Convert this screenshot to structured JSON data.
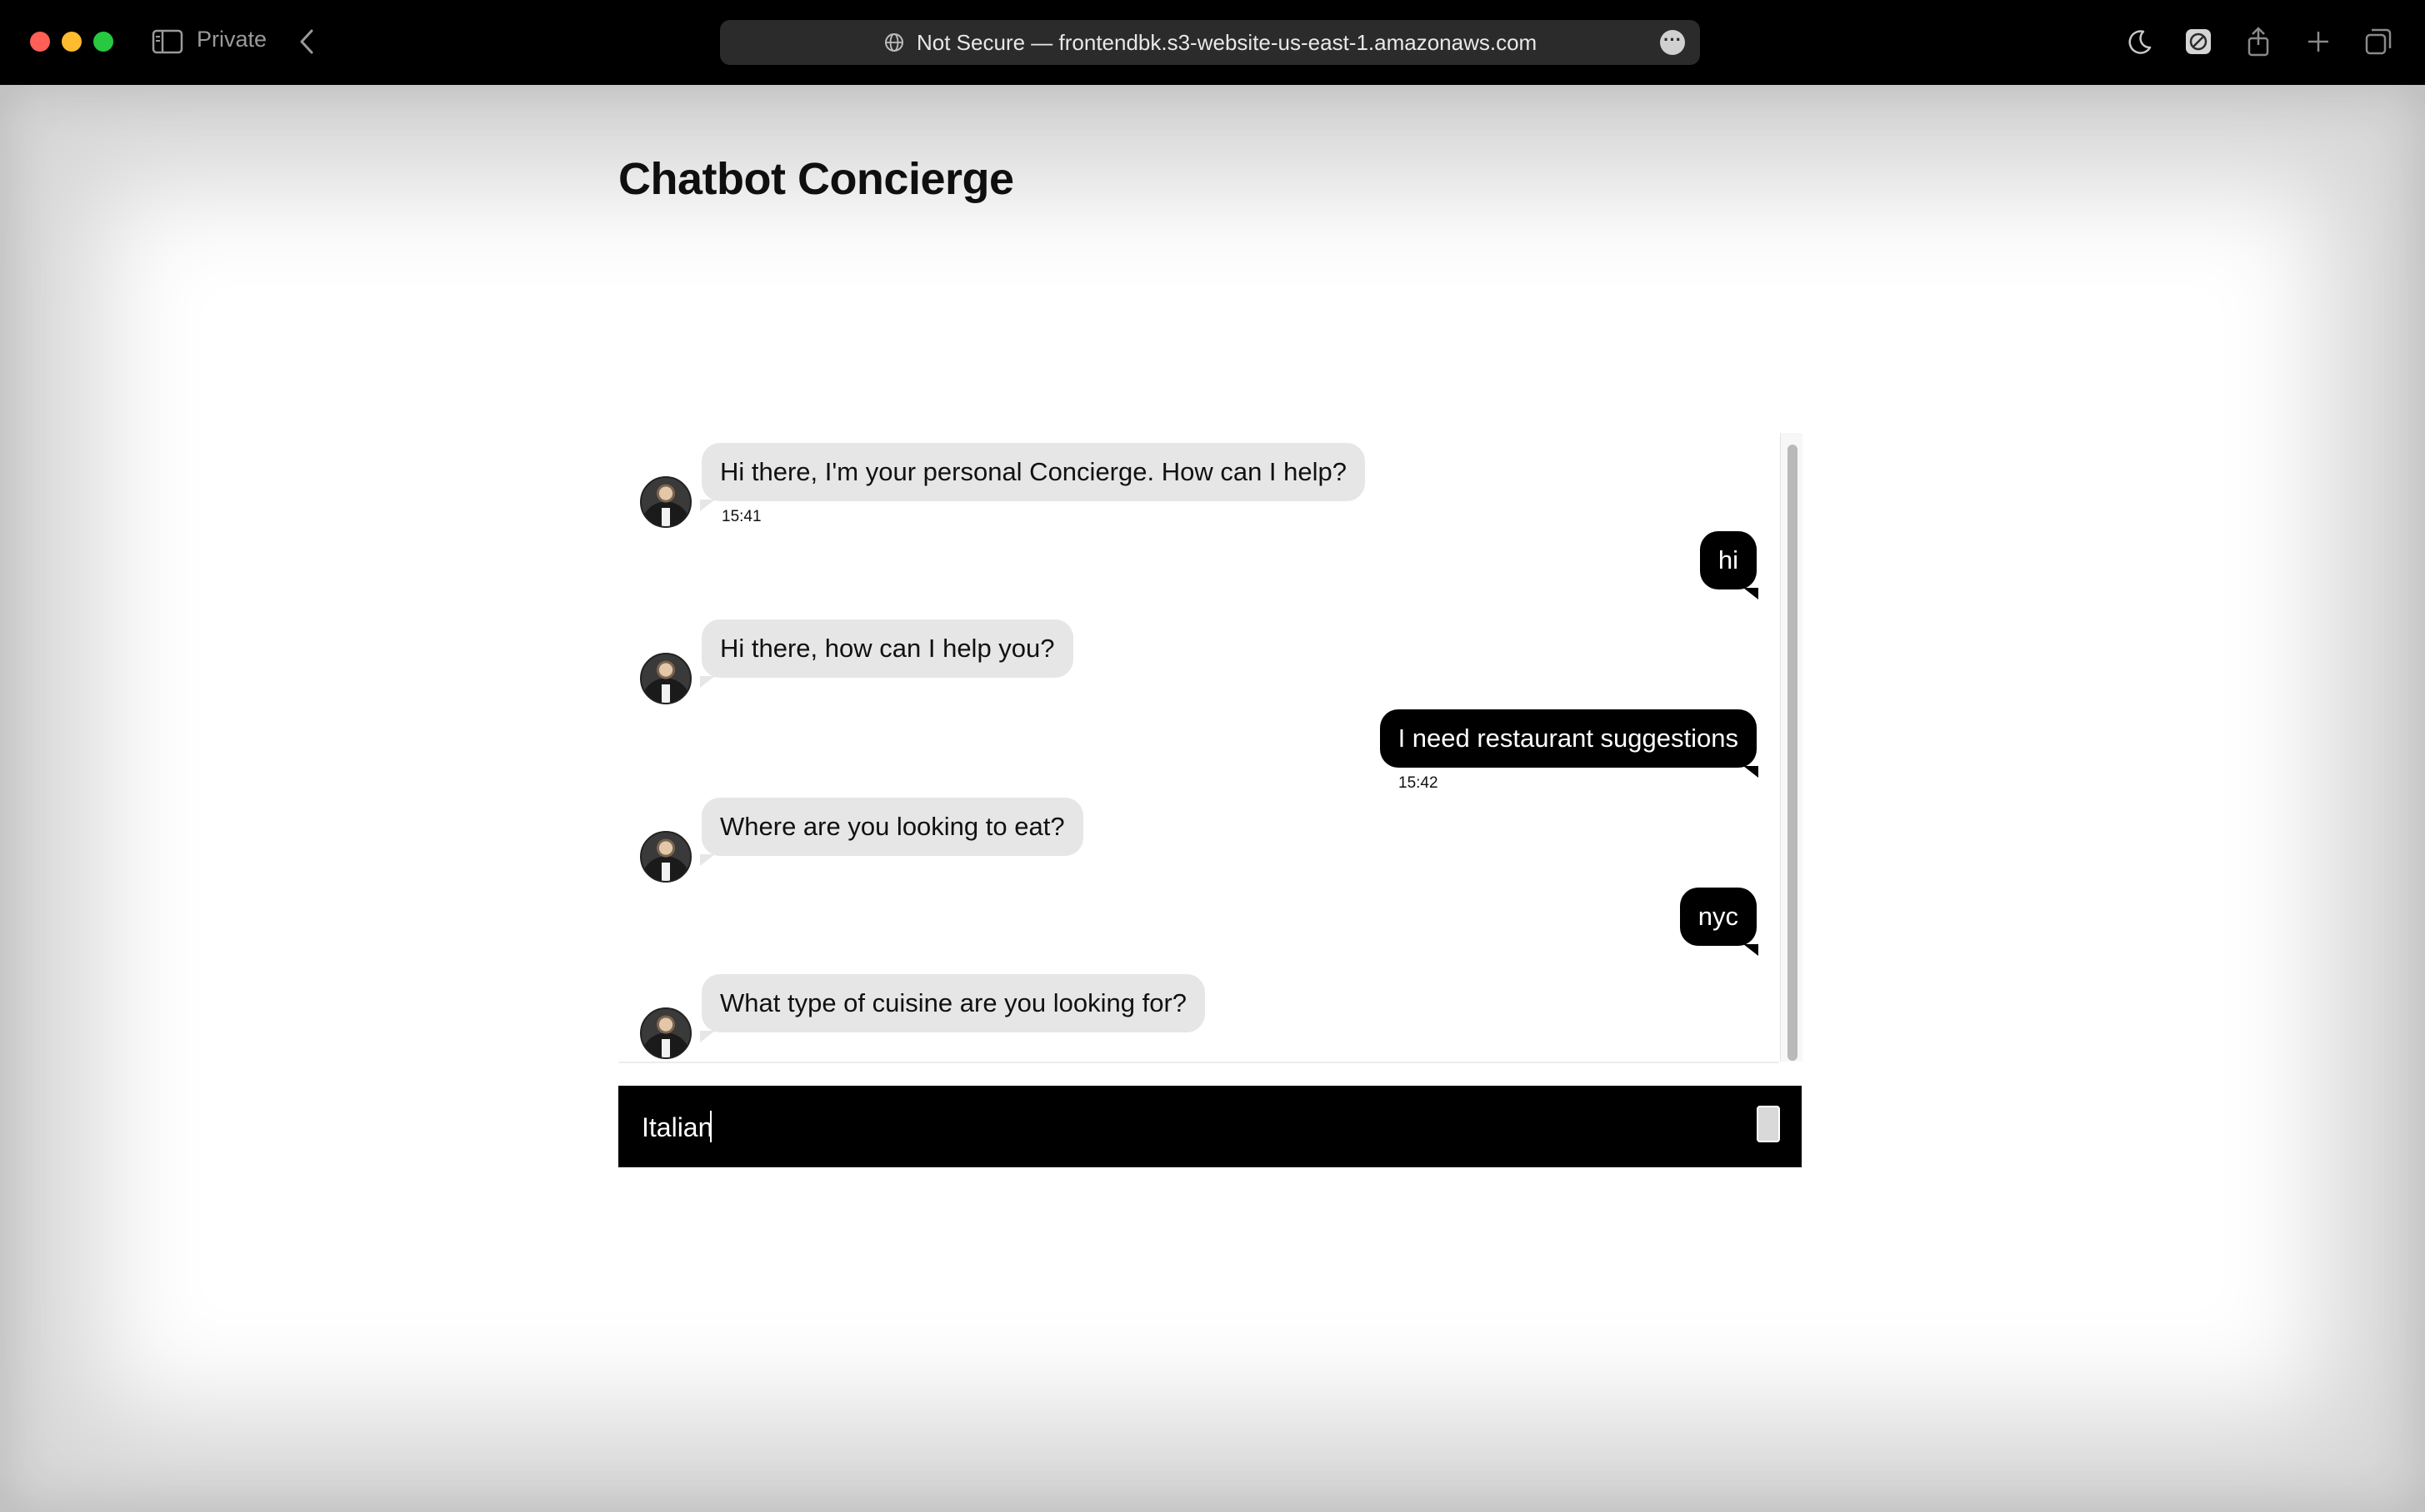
{
  "browser": {
    "mode_label": "Private",
    "address_text": "Not Secure — frontendbk.s3-website-us-east-1.amazonaws.com",
    "icons": [
      "sidebar-icon",
      "back-icon",
      "globe-icon",
      "more-icon",
      "moon-icon",
      "extension-icon",
      "share-icon",
      "new-tab-icon",
      "tab-overview-icon"
    ]
  },
  "page": {
    "title": "Chatbot Concierge"
  },
  "chat": {
    "messages": [
      {
        "sender": "bot",
        "text": "Hi there, I'm your personal Concierge. How can I help?",
        "time": "15:41"
      },
      {
        "sender": "user",
        "text": "hi"
      },
      {
        "sender": "bot",
        "text": "Hi there, how can I help you?"
      },
      {
        "sender": "user",
        "text": "I need restaurant suggestions",
        "time": "15:42"
      },
      {
        "sender": "bot",
        "text": "Where are you looking to eat?"
      },
      {
        "sender": "user",
        "text": "nyc"
      },
      {
        "sender": "bot",
        "text": "What type of cuisine are you looking for?"
      }
    ],
    "input_value": "Italian"
  },
  "colors": {
    "user_bubble": "#000000",
    "bot_bubble": "#e6e6e6",
    "input_bar": "#000000"
  }
}
